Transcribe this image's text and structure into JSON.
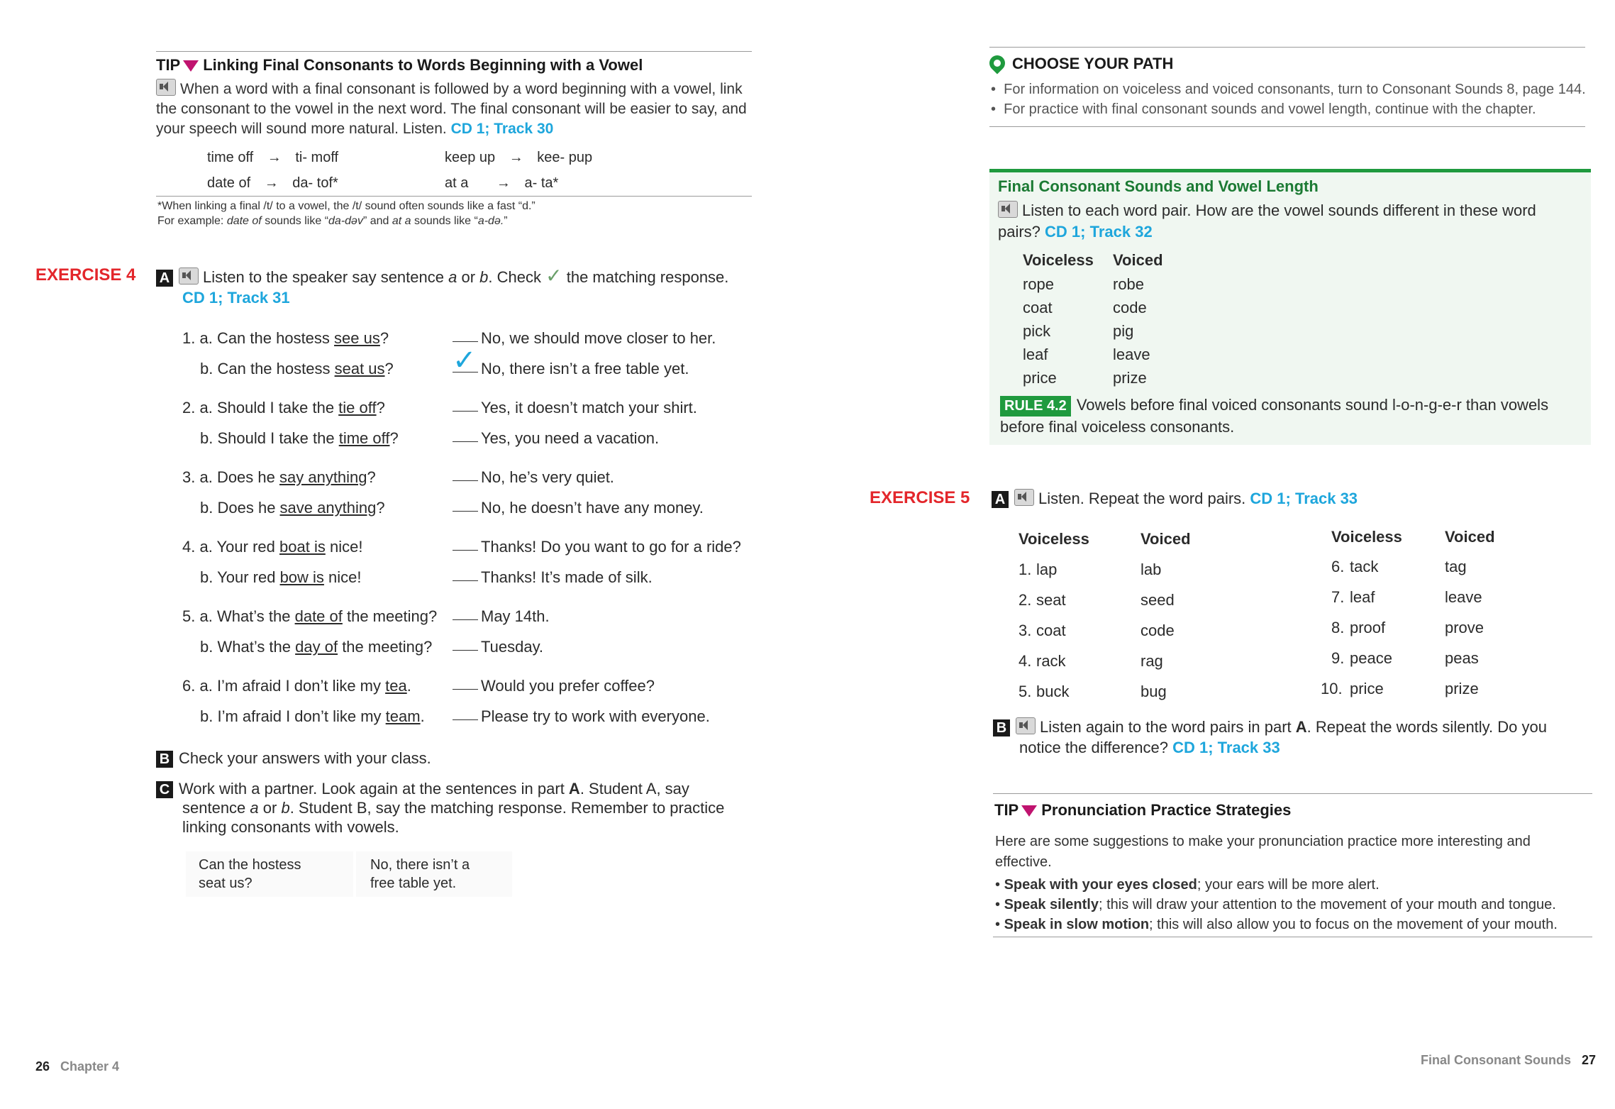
{
  "left_page": {
    "tip": {
      "label": "TIP",
      "title": "Linking Final Consonants to Words Beginning with a Vowel",
      "body_1": "When a word with a final consonant is followed by a word beginning with a vowel, link",
      "body_2": "the consonant to the vowel in the next word. The final consonant will be easier to say, and",
      "body_3": "your speech will sound more natural. Listen.",
      "track": "CD 1; Track 30",
      "examples": [
        {
          "phrase": "time off",
          "arrow": "→",
          "result": "ti- moff"
        },
        {
          "phrase": "keep up",
          "arrow": "→",
          "result": "kee- pup"
        },
        {
          "phrase": "date of",
          "arrow": "→",
          "result": "da- tof*"
        },
        {
          "phrase": "at a",
          "arrow": "→",
          "result": "a- ta*"
        }
      ],
      "note_1": "*When linking a final /t/ to a vowel, the /t/ sound often sounds like a fast “d.”",
      "note_2_pre": "For example: ",
      "note_2_it1": "date of",
      "note_2_mid": " sounds like “",
      "note_2_it2": "da-dəv",
      "note_2_mid2": "” and ",
      "note_2_it3": "at a",
      "note_2_mid3": " sounds like “",
      "note_2_it4": "a-də.",
      "note_2_end": "”"
    },
    "exercise4": {
      "label": "EXERCISE 4",
      "part_a_letter": "A",
      "part_a_text_1": "Listen to the speaker say sentence ",
      "part_a_a": "a",
      "part_a_or": " or ",
      "part_a_b": "b",
      "part_a_text_2": ". Check",
      "part_a_check": "✓",
      "part_a_text_3": "the matching response.",
      "track": "CD 1; Track 31",
      "items": [
        {
          "num": "1. a.",
          "pre": "Can the hostess ",
          "u": "see us",
          "post": "?",
          "resp": "No, we should move closer to her."
        },
        {
          "num": "b.",
          "pre": "Can the hostess ",
          "u": "seat us",
          "post": "?",
          "resp": "No, there isn’t a free table yet."
        },
        {
          "num": "2. a.",
          "pre": "Should I take the ",
          "u": "tie off",
          "post": "?",
          "resp": "Yes, it doesn’t match your shirt."
        },
        {
          "num": "b.",
          "pre": "Should I take the ",
          "u": "time off",
          "post": "?",
          "resp": "Yes, you need a vacation."
        },
        {
          "num": "3. a.",
          "pre": "Does he ",
          "u": "say anything",
          "post": "?",
          "resp": "No, he’s very quiet."
        },
        {
          "num": "b.",
          "pre": "Does he ",
          "u": "save anything",
          "post": "?",
          "resp": "No, he doesn’t have any money."
        },
        {
          "num": "4. a.",
          "pre": "Your red ",
          "u": "boat is",
          "post": " nice!",
          "resp": "Thanks! Do you want to go for a ride?"
        },
        {
          "num": "b.",
          "pre": "Your red ",
          "u": "bow is",
          "post": " nice!",
          "resp": "Thanks! It’s made of silk."
        },
        {
          "num": "5. a.",
          "pre": "What’s the ",
          "u": "date of",
          "post": " the meeting?",
          "resp": "May 14th."
        },
        {
          "num": "b.",
          "pre": "What’s the ",
          "u": "day of",
          "post": " the meeting?",
          "resp": "Tuesday."
        },
        {
          "num": "6. a.",
          "pre": "I’m afraid I don’t like my ",
          "u": "tea",
          "post": ".",
          "resp": "Would you prefer coffee?"
        },
        {
          "num": "b.",
          "pre": "I’m afraid I don’t like my ",
          "u": "team",
          "post": ".",
          "resp": "Please try to work with everyone."
        }
      ],
      "checked_mark": "✓",
      "part_b_letter": "B",
      "part_b_text": "Check your answers with your class.",
      "part_c_letter": "C",
      "part_c_1_pre": "Work with a partner. Look again at the sentences in part ",
      "part_c_1_bold": "A",
      "part_c_1_post": ". Student A, say",
      "part_c_2_pre": "sentence ",
      "part_c_2_a": "a",
      "part_c_2_or": " or ",
      "part_c_2_b": "b",
      "part_c_2_post": ". Student B, say the matching response. Remember to practice",
      "part_c_3": "linking consonants with vowels.",
      "bubble_a_1": "Can the hostess",
      "bubble_a_2": "seat us?",
      "bubble_b_1": "No, there isn’t a",
      "bubble_b_2": "free table yet."
    },
    "footer_page": "26",
    "footer_chapter": "Chapter 4"
  },
  "right_page": {
    "path": {
      "title": "CHOOSE YOUR PATH",
      "bullet_1_pre": "For information on voiceless and voiced consonants, turn to Consonant Sounds 8, page 144.",
      "bullet_2": "For practice with final consonant sounds and vowel length, continue with the chapter."
    },
    "rule_box": {
      "title": "Final Consonant Sounds and Vowel Length",
      "intro_1": "Listen to each word pair. How are the vowel sounds different in these word",
      "intro_2": "pairs?",
      "track": "CD 1; Track 32",
      "col_voiceless": "Voiceless",
      "col_voiced": "Voiced",
      "pairs": [
        {
          "voiceless": "rope",
          "voiced": "robe"
        },
        {
          "voiceless": "coat",
          "voiced": "code"
        },
        {
          "voiceless": "pick",
          "voiced": "pig"
        },
        {
          "voiceless": "leaf",
          "voiced": "leave"
        },
        {
          "voiceless": "price",
          "voiced": "prize"
        }
      ],
      "rule_tag": "RULE 4.2",
      "rule_1": "Vowels before final voiced consonants sound l-o-n-g-e-r than vowels",
      "rule_2": "before final voiceless consonants."
    },
    "exercise5": {
      "label": "EXERCISE 5",
      "part_a_letter": "A",
      "part_a_text": "Listen. Repeat the word pairs.",
      "track": "CD 1; Track 33",
      "col_voiceless": "Voiceless",
      "col_voiced": "Voiced",
      "left_rows": [
        {
          "num": "1.",
          "voiceless": "lap",
          "voiced": "lab"
        },
        {
          "num": "2.",
          "voiceless": "seat",
          "voiced": "seed"
        },
        {
          "num": "3.",
          "voiceless": "coat",
          "voiced": "code"
        },
        {
          "num": "4.",
          "voiceless": "rack",
          "voiced": "rag"
        },
        {
          "num": "5.",
          "voiceless": "buck",
          "voiced": "bug"
        }
      ],
      "right_rows": [
        {
          "num": "6.",
          "voiceless": "tack",
          "voiced": "tag"
        },
        {
          "num": "7.",
          "voiceless": "leaf",
          "voiced": "leave"
        },
        {
          "num": "8.",
          "voiceless": "proof",
          "voiced": "prove"
        },
        {
          "num": "9.",
          "voiceless": "peace",
          "voiced": "peas"
        },
        {
          "num": "10.",
          "voiceless": "price",
          "voiced": "prize"
        }
      ],
      "part_b_letter": "B",
      "part_b_1_pre": "Listen again to the word pairs in part ",
      "part_b_1_bold": "A",
      "part_b_1_post": ". Repeat the words silently. Do you",
      "part_b_2": "notice the difference?",
      "part_b_track": "CD 1; Track 33"
    },
    "tip2": {
      "label": "TIP",
      "title": "Pronunciation Practice Strategies",
      "intro_1": "Here are some suggestions to make your pronunciation practice more interesting and",
      "intro_2": "effective.",
      "items": [
        {
          "bold": "Speak with your eyes closed",
          "rest": "; your ears will be more alert."
        },
        {
          "bold": "Speak silently",
          "rest": "; this will draw your attention to the movement of your mouth and tongue."
        },
        {
          "bold": "Speak in slow motion",
          "rest": "; this will also allow you to focus on the movement of your mouth."
        }
      ]
    },
    "footer_title": "Final Consonant Sounds",
    "footer_page": "27"
  }
}
